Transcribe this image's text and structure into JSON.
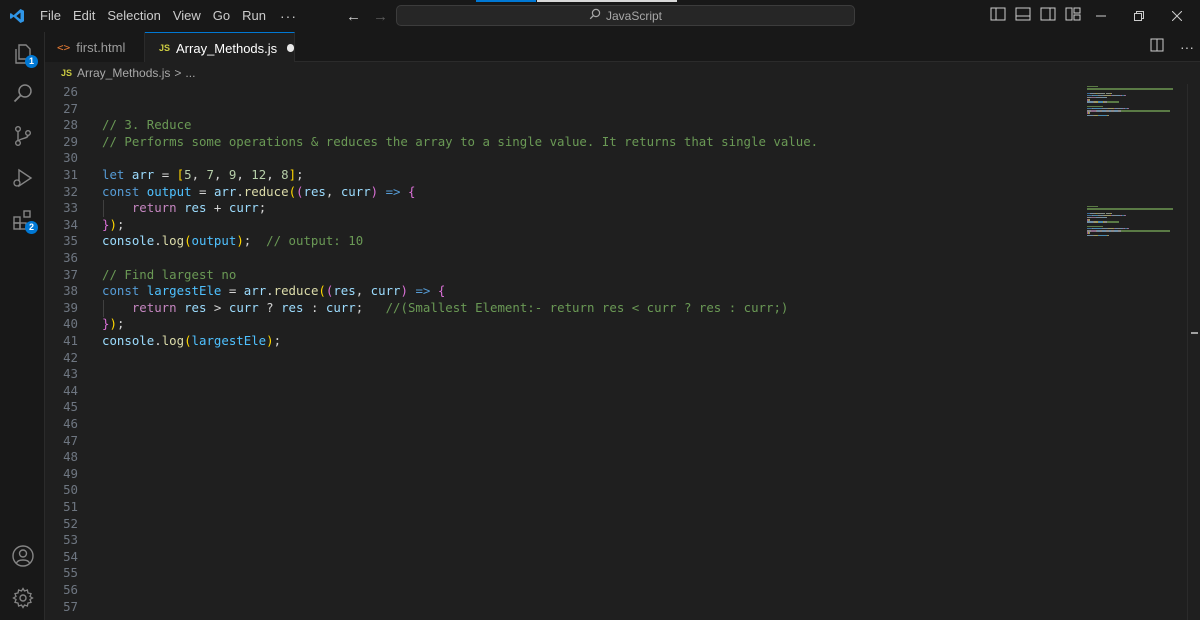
{
  "menu": {
    "items": [
      "File",
      "Edit",
      "Selection",
      "View",
      "Go",
      "Run"
    ],
    "more": "···"
  },
  "command_center": {
    "text": "JavaScript"
  },
  "activity_badges": {
    "explorer": "1",
    "extensions": "2"
  },
  "tabs": [
    {
      "label": "first.html",
      "icon": "html-file-icon",
      "active": false
    },
    {
      "label": "Array_Methods.js",
      "icon": "js-file-icon",
      "active": true,
      "dirty": true
    }
  ],
  "file_icon_text": "JS",
  "html_icon_text": "<>",
  "breadcrumb": {
    "file": "Array_Methods.js",
    "sep": ">",
    "more": "..."
  },
  "editor": {
    "lines": [
      {
        "n": "26",
        "t": []
      },
      {
        "n": "27",
        "t": []
      },
      {
        "n": "28",
        "t": [
          [
            "com",
            "// 3. Reduce"
          ]
        ]
      },
      {
        "n": "29",
        "t": [
          [
            "com",
            "// Performs some operations & reduces the array to a single value. It returns that single value."
          ]
        ]
      },
      {
        "n": "30",
        "t": []
      },
      {
        "n": "31",
        "t": [
          [
            "kw",
            "let"
          ],
          [
            "op",
            " "
          ],
          [
            "var",
            "arr"
          ],
          [
            "op",
            " = "
          ],
          [
            "b1",
            "["
          ],
          [
            "num",
            "5"
          ],
          [
            "op",
            ", "
          ],
          [
            "num",
            "7"
          ],
          [
            "op",
            ", "
          ],
          [
            "num",
            "9"
          ],
          [
            "op",
            ", "
          ],
          [
            "num",
            "12"
          ],
          [
            "op",
            ", "
          ],
          [
            "num",
            "8"
          ],
          [
            "b1",
            "]"
          ],
          [
            "op",
            ";"
          ]
        ]
      },
      {
        "n": "32",
        "t": [
          [
            "kw",
            "const"
          ],
          [
            "op",
            " "
          ],
          [
            "const",
            "output"
          ],
          [
            "op",
            " = "
          ],
          [
            "var",
            "arr"
          ],
          [
            "op",
            "."
          ],
          [
            "fn",
            "reduce"
          ],
          [
            "b1",
            "("
          ],
          [
            "b2",
            "("
          ],
          [
            "var",
            "res"
          ],
          [
            "op",
            ", "
          ],
          [
            "var",
            "curr"
          ],
          [
            "b2",
            ")"
          ],
          [
            "op",
            " "
          ],
          [
            "kw",
            "=>"
          ],
          [
            "op",
            " "
          ],
          [
            "b2",
            "{"
          ]
        ]
      },
      {
        "n": "33",
        "t": [
          [
            "op",
            "    "
          ],
          [
            "ctl",
            "return"
          ],
          [
            "op",
            " "
          ],
          [
            "var",
            "res"
          ],
          [
            "op",
            " + "
          ],
          [
            "var",
            "curr"
          ],
          [
            "op",
            ";"
          ]
        ]
      },
      {
        "n": "34",
        "t": [
          [
            "b2",
            "}"
          ],
          [
            "b1",
            ")"
          ],
          [
            "op",
            ";"
          ]
        ]
      },
      {
        "n": "35",
        "t": [
          [
            "var",
            "console"
          ],
          [
            "op",
            "."
          ],
          [
            "fn",
            "log"
          ],
          [
            "b1",
            "("
          ],
          [
            "const",
            "output"
          ],
          [
            "b1",
            ")"
          ],
          [
            "op",
            ";  "
          ],
          [
            "com",
            "// output: 10"
          ]
        ]
      },
      {
        "n": "36",
        "t": []
      },
      {
        "n": "37",
        "t": [
          [
            "com",
            "// Find largest no"
          ]
        ]
      },
      {
        "n": "38",
        "t": [
          [
            "kw",
            "const"
          ],
          [
            "op",
            " "
          ],
          [
            "const",
            "largestEle"
          ],
          [
            "op",
            " = "
          ],
          [
            "var",
            "arr"
          ],
          [
            "op",
            "."
          ],
          [
            "fn",
            "reduce"
          ],
          [
            "b1",
            "("
          ],
          [
            "b2",
            "("
          ],
          [
            "var",
            "res"
          ],
          [
            "op",
            ", "
          ],
          [
            "var",
            "curr"
          ],
          [
            "b2",
            ")"
          ],
          [
            "op",
            " "
          ],
          [
            "kw",
            "=>"
          ],
          [
            "op",
            " "
          ],
          [
            "b2",
            "{"
          ]
        ]
      },
      {
        "n": "39",
        "t": [
          [
            "op",
            "    "
          ],
          [
            "ctl",
            "return"
          ],
          [
            "op",
            " "
          ],
          [
            "var",
            "res"
          ],
          [
            "op",
            " > "
          ],
          [
            "var",
            "curr"
          ],
          [
            "op",
            " ? "
          ],
          [
            "var",
            "res"
          ],
          [
            "op",
            " : "
          ],
          [
            "var",
            "curr"
          ],
          [
            "op",
            ";   "
          ],
          [
            "com",
            "//(Smallest Element:- return res < curr ? res : curr;)"
          ]
        ]
      },
      {
        "n": "40",
        "t": [
          [
            "b2",
            "}"
          ],
          [
            "b1",
            ")"
          ],
          [
            "op",
            ";"
          ]
        ]
      },
      {
        "n": "41",
        "t": [
          [
            "var",
            "console"
          ],
          [
            "op",
            "."
          ],
          [
            "fn",
            "log"
          ],
          [
            "b1",
            "("
          ],
          [
            "const",
            "largestEle"
          ],
          [
            "b1",
            ")"
          ],
          [
            "op",
            ";"
          ]
        ]
      },
      {
        "n": "42",
        "t": []
      },
      {
        "n": "43",
        "t": []
      },
      {
        "n": "44",
        "t": []
      },
      {
        "n": "45",
        "t": []
      },
      {
        "n": "46",
        "t": []
      },
      {
        "n": "47",
        "t": []
      },
      {
        "n": "48",
        "t": []
      },
      {
        "n": "49",
        "t": []
      },
      {
        "n": "50",
        "t": []
      },
      {
        "n": "51",
        "t": []
      },
      {
        "n": "52",
        "t": []
      },
      {
        "n": "53",
        "t": []
      },
      {
        "n": "54",
        "t": []
      },
      {
        "n": "55",
        "t": []
      },
      {
        "n": "56",
        "t": []
      },
      {
        "n": "57",
        "t": []
      }
    ]
  },
  "colors": {
    "accent": "#0078d4",
    "comment": "#6a9955",
    "keyword": "#569cd6",
    "control": "#c586c0",
    "variable": "#9cdcfe",
    "constant": "#4fc1ff",
    "function": "#dcdcaa",
    "number": "#b5cea8",
    "bracket1": "#ffd700",
    "bracket2": "#da70d6"
  }
}
